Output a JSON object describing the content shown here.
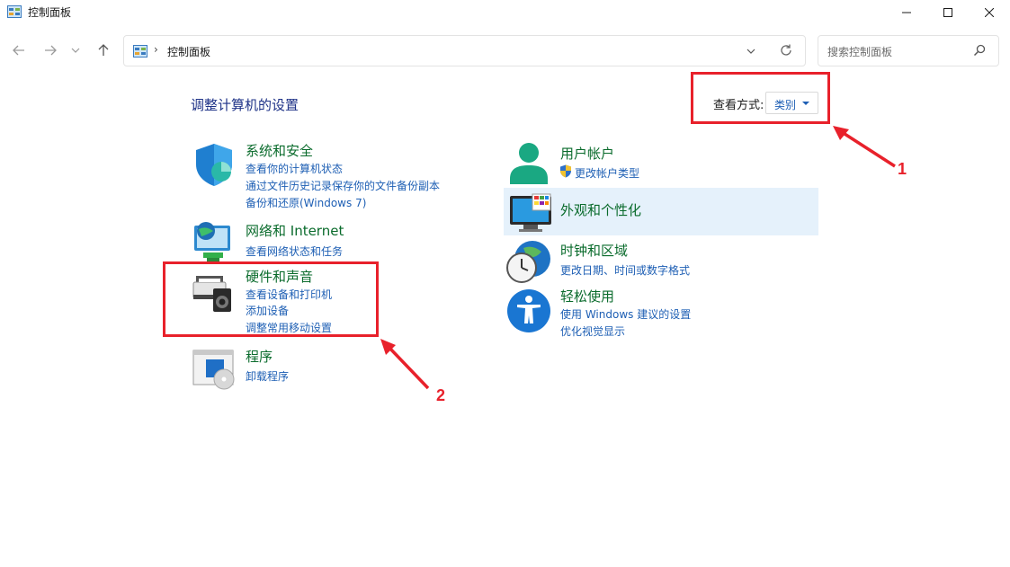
{
  "window": {
    "title": "控制面板"
  },
  "address": {
    "location": "控制面板",
    "separator": "›"
  },
  "search": {
    "placeholder": "搜索控制面板"
  },
  "page": {
    "heading": "调整计算机的设置"
  },
  "view_by": {
    "label": "查看方式:",
    "value": "类别"
  },
  "left_categories": [
    {
      "title": "系统和安全",
      "links": [
        "查看你的计算机状态",
        "通过文件历史记录保存你的文件备份副本",
        "备份和还原(Windows 7)"
      ]
    },
    {
      "title": "网络和 Internet",
      "links": [
        "查看网络状态和任务"
      ]
    },
    {
      "title": "硬件和声音",
      "links": [
        "查看设备和打印机",
        "添加设备",
        "调整常用移动设置"
      ]
    },
    {
      "title": "程序",
      "links": [
        "卸载程序"
      ]
    }
  ],
  "right_categories": [
    {
      "title": "用户帐户",
      "links": [
        "更改帐户类型"
      ]
    },
    {
      "title": "外观和个性化",
      "links": []
    },
    {
      "title": "时钟和区域",
      "links": [
        "更改日期、时间或数字格式"
      ]
    },
    {
      "title": "轻松使用",
      "links": [
        "使用 Windows 建议的设置",
        "优化视觉显示"
      ]
    }
  ],
  "annotations": {
    "marker_1": "1",
    "marker_2": "2",
    "color": "#e8212b"
  },
  "colors": {
    "category_title": "#0a6b2c",
    "link": "#1e5fb4",
    "heading": "#1e3287",
    "hover": "#e5f1fb"
  }
}
